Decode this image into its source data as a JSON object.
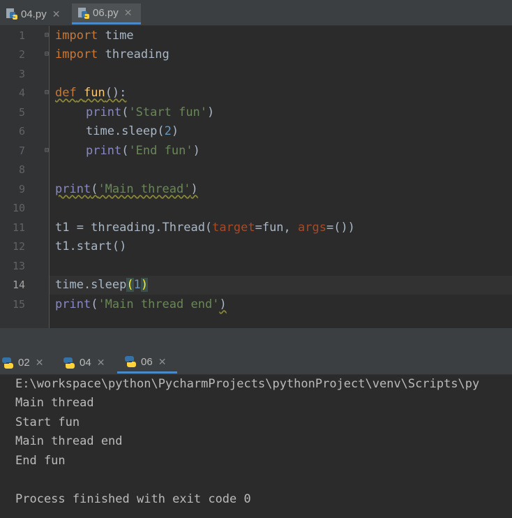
{
  "editor_tabs": [
    {
      "label": "04.py",
      "active": false
    },
    {
      "label": "06.py",
      "active": true
    }
  ],
  "line_numbers": [
    "1",
    "2",
    "3",
    "4",
    "5",
    "6",
    "7",
    "8",
    "9",
    "10",
    "11",
    "12",
    "13",
    "14",
    "15"
  ],
  "current_line": "14",
  "code": {
    "l1_kw": "import",
    "l1_rest": " time",
    "l2_kw": "import",
    "l2_rest": " threading",
    "l4_kw": "def",
    "l4_fn": "fun",
    "l4_rest": "():",
    "l5_builtin": "print",
    "l5_p1": "(",
    "l5_str": "'Start fun'",
    "l5_p2": ")",
    "l6_a": "time.sleep(",
    "l6_num": "2",
    "l6_b": ")",
    "l7_builtin": "print",
    "l7_p1": "(",
    "l7_str": "'End fun'",
    "l7_p2": ")",
    "l9_builtin": "print",
    "l9_p1": "(",
    "l9_str": "'Main thread'",
    "l9_p2": ")",
    "l11_a": "t1 = threading.Thread(",
    "l11_param1": "target",
    "l11_b": "=fun, ",
    "l11_param2": "args",
    "l11_c": "=())",
    "l12": "t1.start()",
    "l14_a": "time.sleep",
    "l14_open": "(",
    "l14_num": "1",
    "l14_close": ")",
    "l15_builtin": "print",
    "l15_p1": "(",
    "l15_str": "'Main thread end'",
    "l15_p2": ")"
  },
  "run_tabs": [
    {
      "label": "02",
      "active": false
    },
    {
      "label": "04",
      "active": false
    },
    {
      "label": "06",
      "active": true
    }
  ],
  "console": {
    "lines": [
      "E:\\workspace\\python\\PycharmProjects\\pythonProject\\venv\\Scripts\\py",
      "Main thread",
      "Start fun",
      "Main thread end",
      "End fun",
      "",
      "Process finished with exit code 0"
    ]
  },
  "icons": {
    "python_file": "python-file-icon",
    "close": "close-icon",
    "fold": "fold-marker-icon"
  },
  "colors": {
    "keyword": "#cc7832",
    "string": "#6a8759",
    "number": "#6897bb",
    "builtin": "#8888c6",
    "function": "#ffc66d",
    "param": "#aa4926",
    "accent": "#4a88c7"
  }
}
